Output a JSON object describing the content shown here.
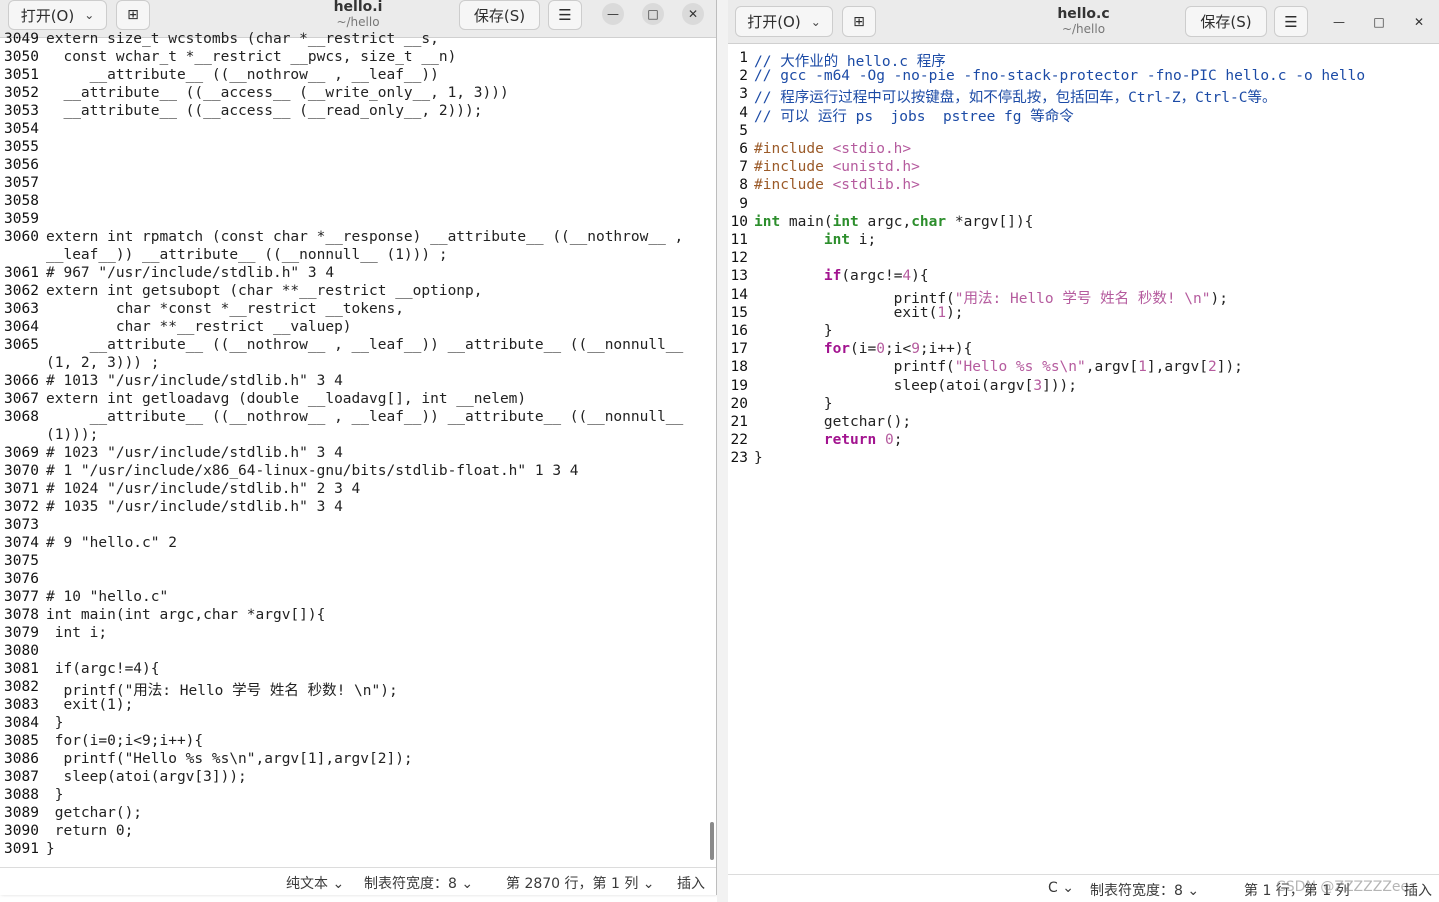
{
  "left_window": {
    "open_label": "打开(O)",
    "title": "hello.i",
    "subtitle": "~/hello",
    "save_label": "保存(S)",
    "status": {
      "lang": "纯文本",
      "tab_width": "制表符宽度：8",
      "position": "第 2870 行，第 1 列",
      "mode": "插入"
    },
    "lines": [
      {
        "n": "3049",
        "t": "extern size_t wcstombs (char *__restrict __s,"
      },
      {
        "n": "3050",
        "t": "  const wchar_t *__restrict __pwcs, size_t __n)"
      },
      {
        "n": "3051",
        "t": "     __attribute__ ((__nothrow__ , __leaf__))"
      },
      {
        "n": "3052",
        "t": "  __attribute__ ((__access__ (__write_only__, 1, 3)))"
      },
      {
        "n": "3053",
        "t": "  __attribute__ ((__access__ (__read_only__, 2)));"
      },
      {
        "n": "3054",
        "t": ""
      },
      {
        "n": "3055",
        "t": ""
      },
      {
        "n": "3056",
        "t": ""
      },
      {
        "n": "3057",
        "t": ""
      },
      {
        "n": "3058",
        "t": ""
      },
      {
        "n": "3059",
        "t": ""
      },
      {
        "n": "3060",
        "t": "extern int rpmatch (const char *__response) __attribute__ ((__nothrow__ ,"
      },
      {
        "n": "",
        "t": "__leaf__)) __attribute__ ((__nonnull__ (1))) ;"
      },
      {
        "n": "3061",
        "t": "# 967 \"/usr/include/stdlib.h\" 3 4"
      },
      {
        "n": "3062",
        "t": "extern int getsubopt (char **__restrict __optionp,"
      },
      {
        "n": "3063",
        "t": "        char *const *__restrict __tokens,"
      },
      {
        "n": "3064",
        "t": "        char **__restrict __valuep)"
      },
      {
        "n": "3065",
        "t": "     __attribute__ ((__nothrow__ , __leaf__)) __attribute__ ((__nonnull__"
      },
      {
        "n": "",
        "t": "(1, 2, 3))) ;"
      },
      {
        "n": "3066",
        "t": "# 1013 \"/usr/include/stdlib.h\" 3 4"
      },
      {
        "n": "3067",
        "t": "extern int getloadavg (double __loadavg[], int __nelem)"
      },
      {
        "n": "3068",
        "t": "     __attribute__ ((__nothrow__ , __leaf__)) __attribute__ ((__nonnull__"
      },
      {
        "n": "",
        "t": "(1)));"
      },
      {
        "n": "3069",
        "t": "# 1023 \"/usr/include/stdlib.h\" 3 4"
      },
      {
        "n": "3070",
        "t": "# 1 \"/usr/include/x86_64-linux-gnu/bits/stdlib-float.h\" 1 3 4"
      },
      {
        "n": "3071",
        "t": "# 1024 \"/usr/include/stdlib.h\" 2 3 4"
      },
      {
        "n": "3072",
        "t": "# 1035 \"/usr/include/stdlib.h\" 3 4"
      },
      {
        "n": "3073",
        "t": ""
      },
      {
        "n": "3074",
        "t": "# 9 \"hello.c\" 2"
      },
      {
        "n": "3075",
        "t": ""
      },
      {
        "n": "3076",
        "t": ""
      },
      {
        "n": "3077",
        "t": "# 10 \"hello.c\""
      },
      {
        "n": "3078",
        "t": "int main(int argc,char *argv[]){"
      },
      {
        "n": "3079",
        "t": " int i;"
      },
      {
        "n": "3080",
        "t": ""
      },
      {
        "n": "3081",
        "t": " if(argc!=4){"
      },
      {
        "n": "3082",
        "t": "  printf(\"用法: Hello 学号 姓名 秒数! \\n\");"
      },
      {
        "n": "3083",
        "t": "  exit(1);"
      },
      {
        "n": "3084",
        "t": " }"
      },
      {
        "n": "3085",
        "t": " for(i=0;i<9;i++){"
      },
      {
        "n": "3086",
        "t": "  printf(\"Hello %s %s\\n\",argv[1],argv[2]);"
      },
      {
        "n": "3087",
        "t": "  sleep(atoi(argv[3]));"
      },
      {
        "n": "3088",
        "t": " }"
      },
      {
        "n": "3089",
        "t": " getchar();"
      },
      {
        "n": "3090",
        "t": " return 0;"
      },
      {
        "n": "3091",
        "t": "}"
      }
    ]
  },
  "right_window": {
    "open_label": "打开(O)",
    "title": "hello.c",
    "subtitle": "~/hello",
    "save_label": "保存(S)",
    "status": {
      "lang": "C",
      "tab_width": "制表符宽度：8",
      "position": "第 1 行，第 1 列",
      "mode": "插入",
      "watermark": "CSDN @ZZZZZZee"
    },
    "lines": [
      {
        "n": "1",
        "t": "// 大作业的 hello.c 程序"
      },
      {
        "n": "2",
        "t": "// gcc -m64 -Og -no-pie -fno-stack-protector -fno-PIC hello.c -o hello"
      },
      {
        "n": "3",
        "t": "// 程序运行过程中可以按键盘，如不停乱按，包括回车，Ctrl-Z，Ctrl-C等。"
      },
      {
        "n": "4",
        "t": "// 可以 运行 ps  jobs  pstree fg 等命令"
      },
      {
        "n": "5",
        "t": ""
      },
      {
        "n": "6",
        "t": "#include <stdio.h>"
      },
      {
        "n": "7",
        "t": "#include <unistd.h>"
      },
      {
        "n": "8",
        "t": "#include <stdlib.h>"
      },
      {
        "n": "9",
        "t": ""
      },
      {
        "n": "10",
        "t": "int main(int argc,char *argv[]){"
      },
      {
        "n": "11",
        "t": "        int i;"
      },
      {
        "n": "12",
        "t": ""
      },
      {
        "n": "13",
        "t": "        if(argc!=4){"
      },
      {
        "n": "14",
        "t": "                printf(\"用法: Hello 学号 姓名 秒数! \\n\");"
      },
      {
        "n": "15",
        "t": "                exit(1);"
      },
      {
        "n": "16",
        "t": "        }"
      },
      {
        "n": "17",
        "t": "        for(i=0;i<9;i++){"
      },
      {
        "n": "18",
        "t": "                printf(\"Hello %s %s\\n\",argv[1],argv[2]);"
      },
      {
        "n": "19",
        "t": "                sleep(atoi(argv[3]));"
      },
      {
        "n": "20",
        "t": "        }"
      },
      {
        "n": "21",
        "t": "        getchar();"
      },
      {
        "n": "22",
        "t": "        return 0;"
      },
      {
        "n": "23",
        "t": "}"
      }
    ]
  }
}
